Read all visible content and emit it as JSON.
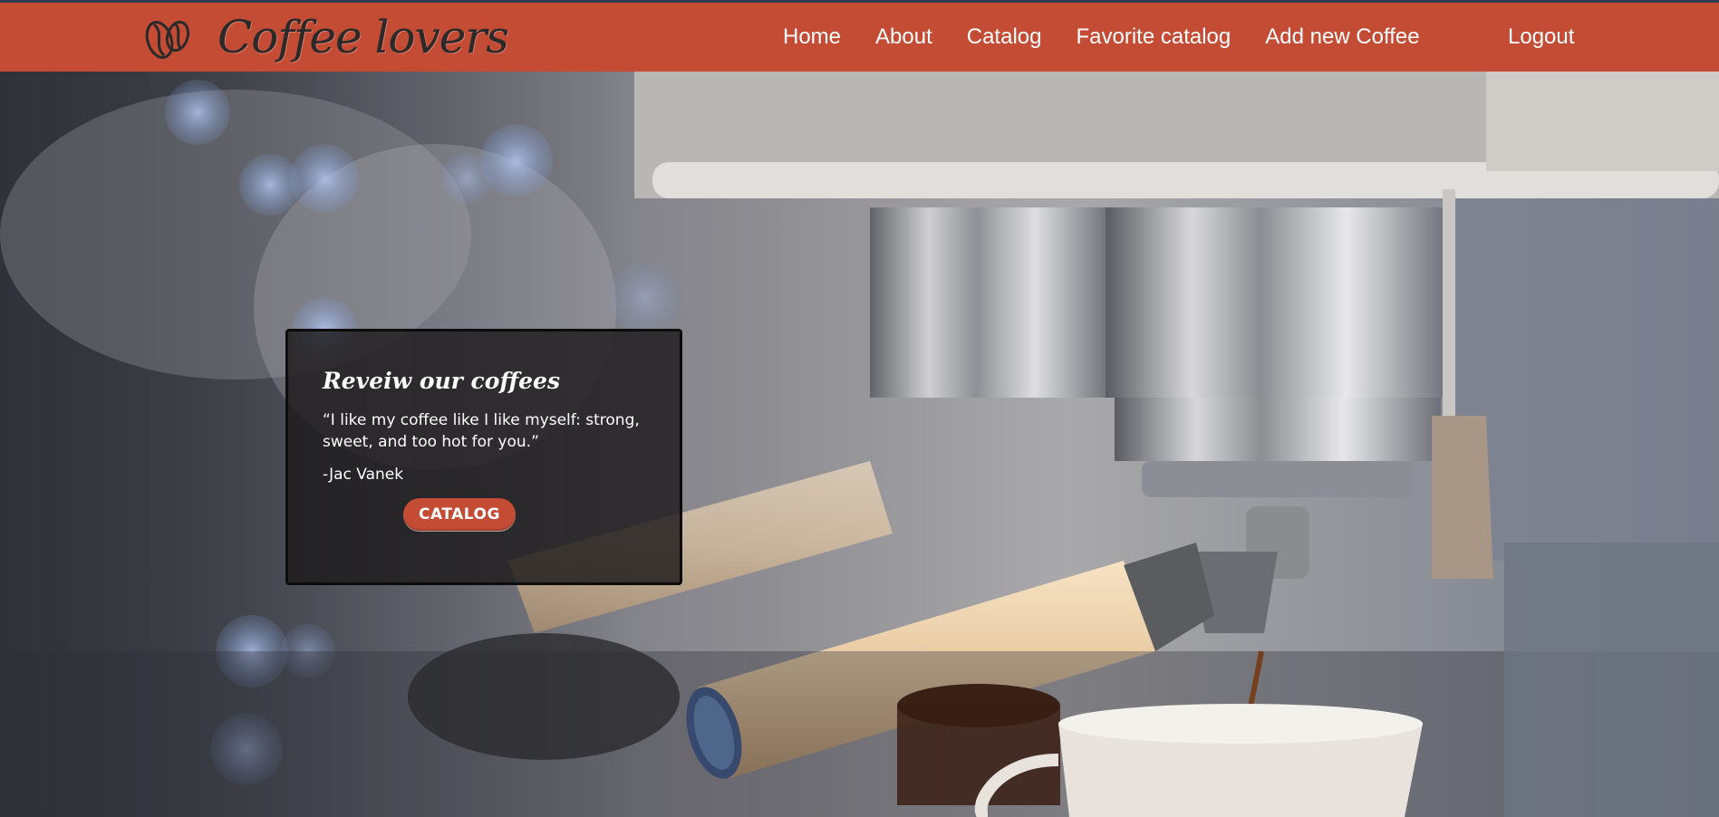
{
  "header": {
    "brand_name": "Coffee lovers",
    "logo_icon": "coffee-beans-icon",
    "nav_items": [
      {
        "label": "Home"
      },
      {
        "label": "About"
      },
      {
        "label": "Catalog"
      },
      {
        "label": "Favorite catalog"
      },
      {
        "label": "Add new Coffee"
      }
    ],
    "logout_label": "Logout"
  },
  "review": {
    "title": "Reveiw our coffees",
    "quote": "“I like my coffee like I like myself: strong, sweet, and too hot for you.”",
    "author": "-Jac Vanek",
    "button_label": "CATALOG"
  },
  "colors": {
    "navbar": "#c44b34",
    "top_strip": "#2c3e50",
    "button": "#c44b34",
    "card_background": "rgba(28,26,27,0.82)",
    "nav_text": "#ffffff"
  }
}
